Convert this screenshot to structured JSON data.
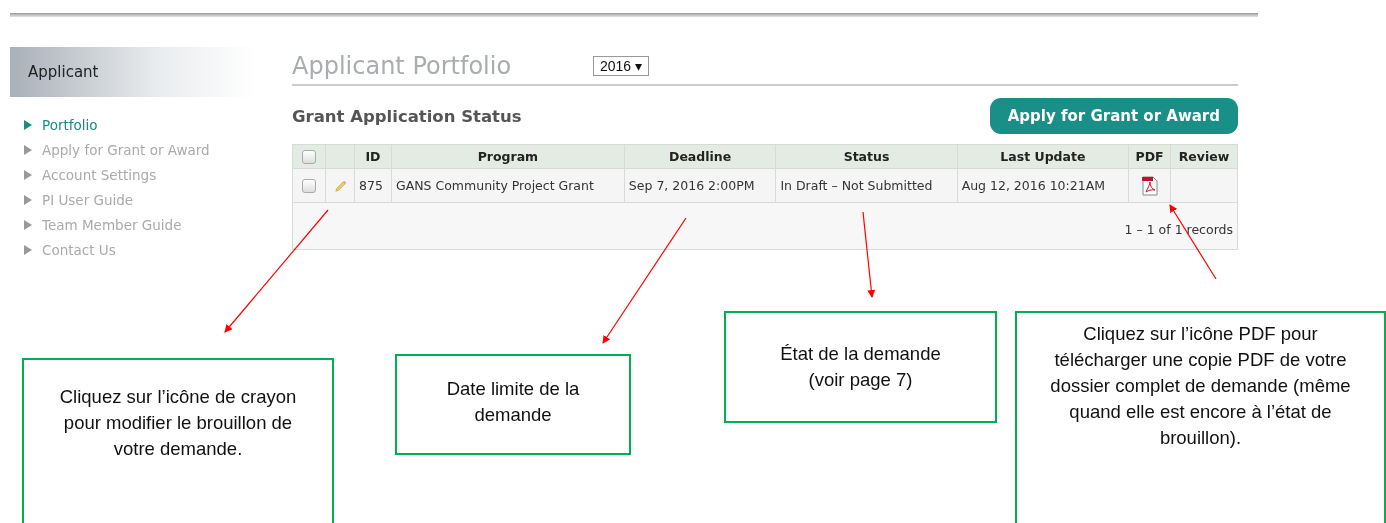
{
  "sidebar": {
    "title": "Applicant",
    "items": [
      {
        "label": "Portfolio",
        "selected": true
      },
      {
        "label": "Apply for Grant or Award",
        "selected": false
      },
      {
        "label": "Account Settings",
        "selected": false
      },
      {
        "label": "PI User Guide",
        "selected": false
      },
      {
        "label": "Team Member Guide",
        "selected": false
      },
      {
        "label": "Contact Us",
        "selected": false
      }
    ]
  },
  "main": {
    "title": "Applicant Portfolio",
    "year_select": {
      "value": "2016",
      "caret": "▾"
    },
    "section_title": "Grant Application Status",
    "apply_button": "Apply for Grant or Award",
    "table": {
      "header_checkbox": {
        "checked": false
      },
      "columns": [
        "ID",
        "Program",
        "Deadline",
        "Status",
        "Last Update",
        "PDF",
        "Review"
      ],
      "rows": [
        {
          "checked": false,
          "id": "875",
          "program": "GANS Community Project Grant",
          "deadline": "Sep 7, 2016 2:00PM",
          "status": "In Draft – Not Submitted",
          "last_update": "Aug 12, 2016 10:21AM"
        }
      ],
      "footer": "1 – 1 of 1 records"
    }
  },
  "annotations": [
    {
      "text": "Cliquez sur l’icône de crayon pour modifier le brouillon de votre demande."
    },
    {
      "text": "Date limite de la demande"
    },
    {
      "text": "État de la demande (voir page 7)"
    },
    {
      "text": "Cliquez sur l’icône PDF pour télécharger une copie PDF de votre dossier complet de demande (même quand elle est encore à l’état de brouillon)."
    }
  ]
}
